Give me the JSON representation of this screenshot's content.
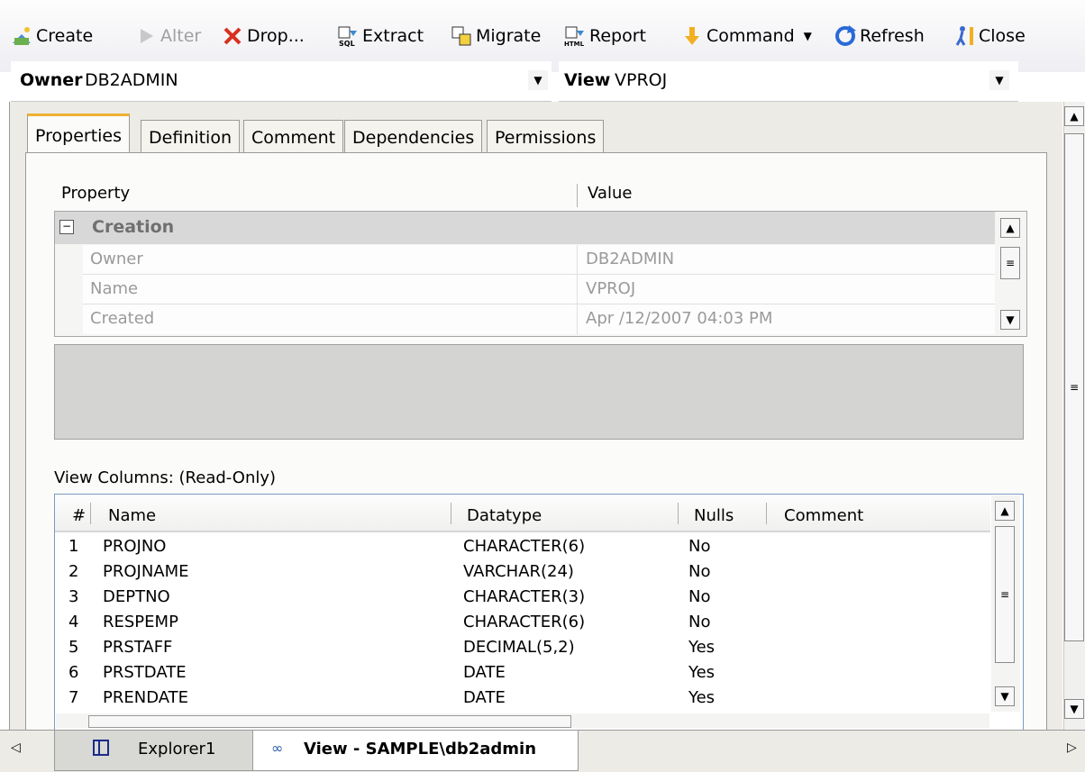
{
  "toolbar": {
    "create": "Create",
    "alter": "Alter",
    "drop": "Drop...",
    "extract": "Extract",
    "migrate": "Migrate",
    "report": "Report",
    "command": "Command",
    "refresh": "Refresh",
    "close": "Close"
  },
  "selectors": {
    "owner_label": "Owner",
    "owner_value": "DB2ADMIN",
    "view_label": "View",
    "view_value": "VPROJ"
  },
  "tabs": [
    "Properties",
    "Definition",
    "Comment",
    "Dependencies",
    "Permissions"
  ],
  "properties": {
    "header_property": "Property",
    "header_value": "Value",
    "group": "Creation",
    "rows": [
      {
        "name": "Owner",
        "value": "DB2ADMIN"
      },
      {
        "name": "Name",
        "value": "VPROJ"
      },
      {
        "name": "Created",
        "value": "Apr /12/2007 04:03 PM"
      }
    ]
  },
  "view_columns": {
    "title": "View Columns: (Read-Only)",
    "headers": {
      "num": "#",
      "name": "Name",
      "datatype": "Datatype",
      "nulls": "Nulls",
      "comment": "Comment"
    },
    "rows": [
      {
        "num": "1",
        "name": "PROJNO",
        "datatype": "CHARACTER(6)",
        "nulls": "No"
      },
      {
        "num": "2",
        "name": "PROJNAME",
        "datatype": "VARCHAR(24)",
        "nulls": "No"
      },
      {
        "num": "3",
        "name": "DEPTNO",
        "datatype": "CHARACTER(3)",
        "nulls": "No"
      },
      {
        "num": "4",
        "name": "RESPEMP",
        "datatype": "CHARACTER(6)",
        "nulls": "No"
      },
      {
        "num": "5",
        "name": "PRSTAFF",
        "datatype": "DECIMAL(5,2)",
        "nulls": "Yes"
      },
      {
        "num": "6",
        "name": "PRSTDATE",
        "datatype": "DATE",
        "nulls": "Yes"
      },
      {
        "num": "7",
        "name": "PRENDATE",
        "datatype": "DATE",
        "nulls": "Yes"
      }
    ]
  },
  "bottom_tabs": {
    "explorer": "Explorer1",
    "view": "View - SAMPLE\\db2admin"
  },
  "colors": {
    "accent_tab": "#f0b030",
    "panel_bg": "#ecebe5"
  }
}
